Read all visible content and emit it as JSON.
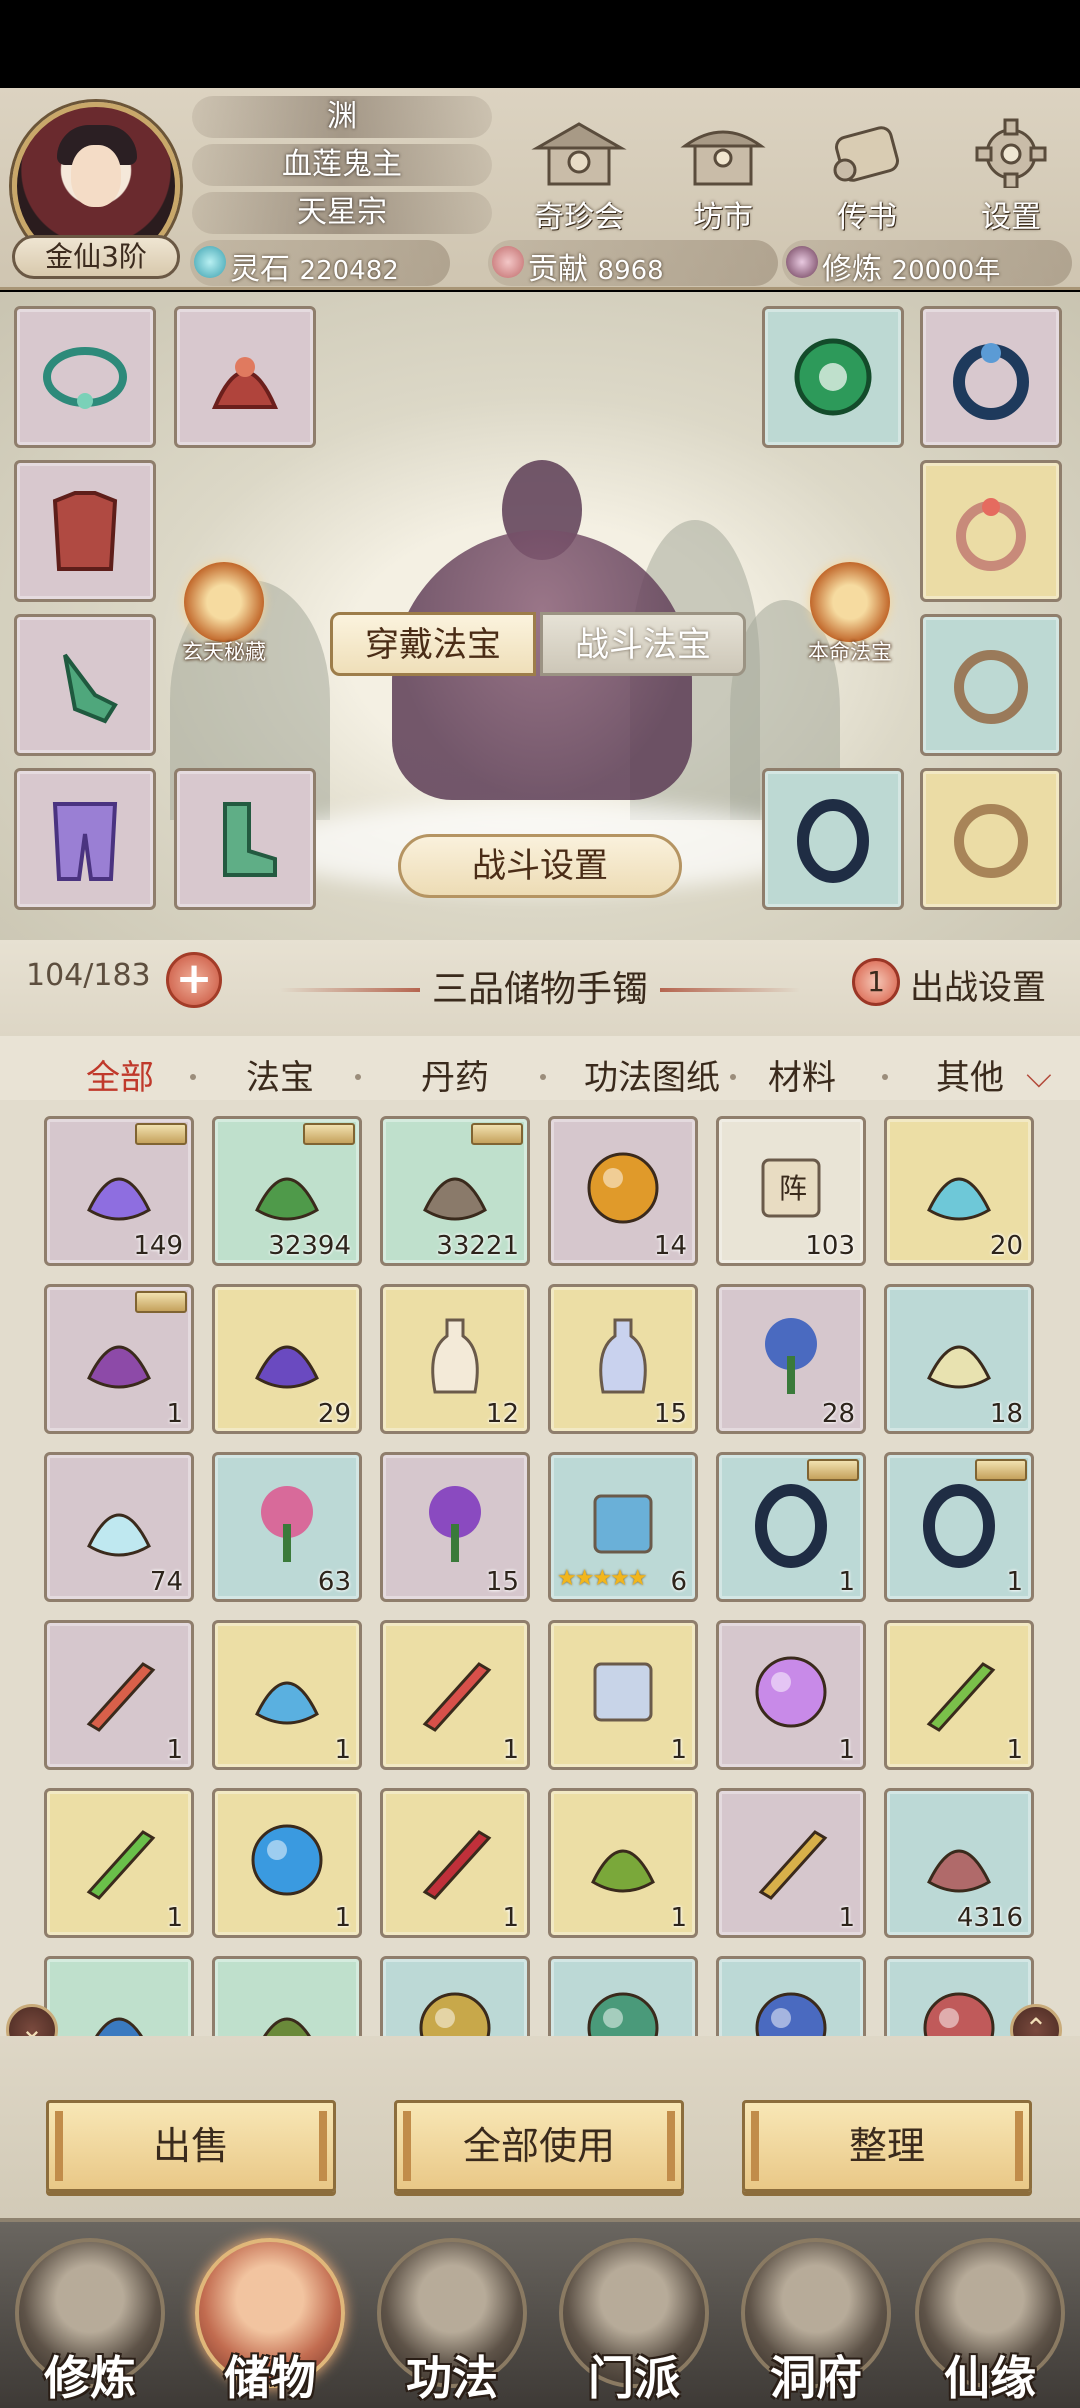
{
  "player": {
    "name": "渊",
    "title": "血莲鬼主",
    "sect": "天星宗",
    "realm": "金仙3阶"
  },
  "top_nav": [
    {
      "label": "奇珍会",
      "icon": "pavilion-icon"
    },
    {
      "label": "坊市",
      "icon": "market-icon"
    },
    {
      "label": "传书",
      "icon": "scroll-letter-icon"
    },
    {
      "label": "设置",
      "icon": "gear-icon"
    }
  ],
  "resources": {
    "spirit_stone": {
      "label": "灵石",
      "value": "220482"
    },
    "contribution": {
      "label": "贡献",
      "value": "8968"
    },
    "cultivation": {
      "label": "修炼",
      "value": "20000年"
    }
  },
  "equip_tabs": {
    "active": "穿戴法宝",
    "inactive": "战斗法宝"
  },
  "special": {
    "left": "玄天秘藏",
    "right": "本命法宝"
  },
  "battle_settings_label": "战斗设置",
  "bag": {
    "capacity": "104/183",
    "plus": "+",
    "title": "三品储物手镯",
    "sortie_count": "1",
    "sortie_label": "出战设置"
  },
  "categories": [
    "全部",
    "法宝",
    "丹药",
    "功法图纸",
    "材料",
    "其他"
  ],
  "active_category": "全部",
  "items": [
    {
      "qty": "149",
      "color": "p",
      "icon": "purple-crystal-icon",
      "tag": true
    },
    {
      "qty": "32394",
      "color": "g",
      "icon": "herb-sprout-icon",
      "tag": true
    },
    {
      "qty": "33221",
      "color": "g",
      "icon": "ore-rock-icon",
      "tag": true
    },
    {
      "qty": "14",
      "color": "p",
      "icon": "golden-orb-icon",
      "tag": false
    },
    {
      "qty": "103",
      "color": "w",
      "icon": "formation-scroll-icon",
      "tag": false,
      "scroll_text": "阵"
    },
    {
      "qty": "20",
      "color": "y",
      "icon": "spirit-bowl-icon",
      "tag": false
    },
    {
      "qty": "1",
      "color": "p",
      "icon": "seed-pile-icon",
      "tag": true
    },
    {
      "qty": "29",
      "color": "y",
      "icon": "purple-coral-icon",
      "tag": false
    },
    {
      "qty": "12",
      "color": "y",
      "icon": "white-vase-icon",
      "tag": false
    },
    {
      "qty": "15",
      "color": "y",
      "icon": "blue-vase-icon",
      "tag": false
    },
    {
      "qty": "28",
      "color": "p",
      "icon": "blue-mushroom-icon",
      "tag": false
    },
    {
      "qty": "18",
      "color": "t",
      "icon": "corn-plant-icon",
      "tag": false
    },
    {
      "qty": "74",
      "color": "p",
      "icon": "crystal-corn-icon",
      "tag": false
    },
    {
      "qty": "63",
      "color": "t",
      "icon": "pink-flower-icon",
      "tag": false
    },
    {
      "qty": "15",
      "color": "p",
      "icon": "purple-flower-icon",
      "tag": false
    },
    {
      "qty": "6",
      "color": "t",
      "icon": "star-banner-icon",
      "tag": false,
      "stars": "★★★★★"
    },
    {
      "qty": "1",
      "color": "t",
      "icon": "dark-ring-icon",
      "tag": true
    },
    {
      "qty": "1",
      "color": "t",
      "icon": "dark-ring-icon",
      "tag": true
    },
    {
      "qty": "1",
      "color": "p",
      "icon": "red-sword-icon",
      "tag": false
    },
    {
      "qty": "1",
      "color": "y",
      "icon": "jade-ruyi-icon",
      "tag": false
    },
    {
      "qty": "1",
      "color": "y",
      "icon": "flame-sword-icon",
      "tag": false
    },
    {
      "qty": "1",
      "color": "y",
      "icon": "lightning-scroll-icon",
      "tag": false
    },
    {
      "qty": "1",
      "color": "p",
      "icon": "purple-pearl-icon",
      "tag": false
    },
    {
      "qty": "1",
      "color": "y",
      "icon": "green-blade-icon",
      "tag": false
    },
    {
      "qty": "1",
      "color": "y",
      "icon": "green-dagger-icon",
      "tag": false
    },
    {
      "qty": "1",
      "color": "y",
      "icon": "blue-orb-icon",
      "tag": false
    },
    {
      "qty": "1",
      "color": "y",
      "icon": "red-blade-icon",
      "tag": false
    },
    {
      "qty": "1",
      "color": "y",
      "icon": "green-umbrella-icon",
      "tag": false
    },
    {
      "qty": "1",
      "color": "p",
      "icon": "golden-sickle-icon",
      "tag": false
    },
    {
      "qty": "4316",
      "color": "t",
      "icon": "red-mound-icon",
      "tag": false
    },
    {
      "qty": "",
      "color": "g",
      "icon": "blue-spike-icon",
      "tag": false
    },
    {
      "qty": "",
      "color": "g",
      "icon": "green-dragon-icon",
      "tag": false
    },
    {
      "qty": "",
      "color": "t",
      "icon": "gold-sphere-icon",
      "tag": false
    },
    {
      "qty": "",
      "color": "t",
      "icon": "green-sphere-icon",
      "tag": false
    },
    {
      "qty": "",
      "color": "t",
      "icon": "blue-sphere-icon",
      "tag": false
    },
    {
      "qty": "",
      "color": "t",
      "icon": "red-sphere-icon",
      "tag": false
    }
  ],
  "actions": [
    "出售",
    "全部使用",
    "整理"
  ],
  "bottom_nav": [
    {
      "label": "修炼",
      "icon": "cultivate-icon"
    },
    {
      "label": "储物",
      "icon": "storage-bag-icon"
    },
    {
      "label": "功法",
      "icon": "technique-scroll-icon"
    },
    {
      "label": "门派",
      "icon": "sect-gate-icon"
    },
    {
      "label": "洞府",
      "icon": "cave-residence-icon"
    },
    {
      "label": "仙缘",
      "icon": "fate-yinyang-icon"
    }
  ],
  "active_bottom_nav": "储物",
  "colors": {
    "active_tab": "#c0392b",
    "button": "#e9c887"
  }
}
